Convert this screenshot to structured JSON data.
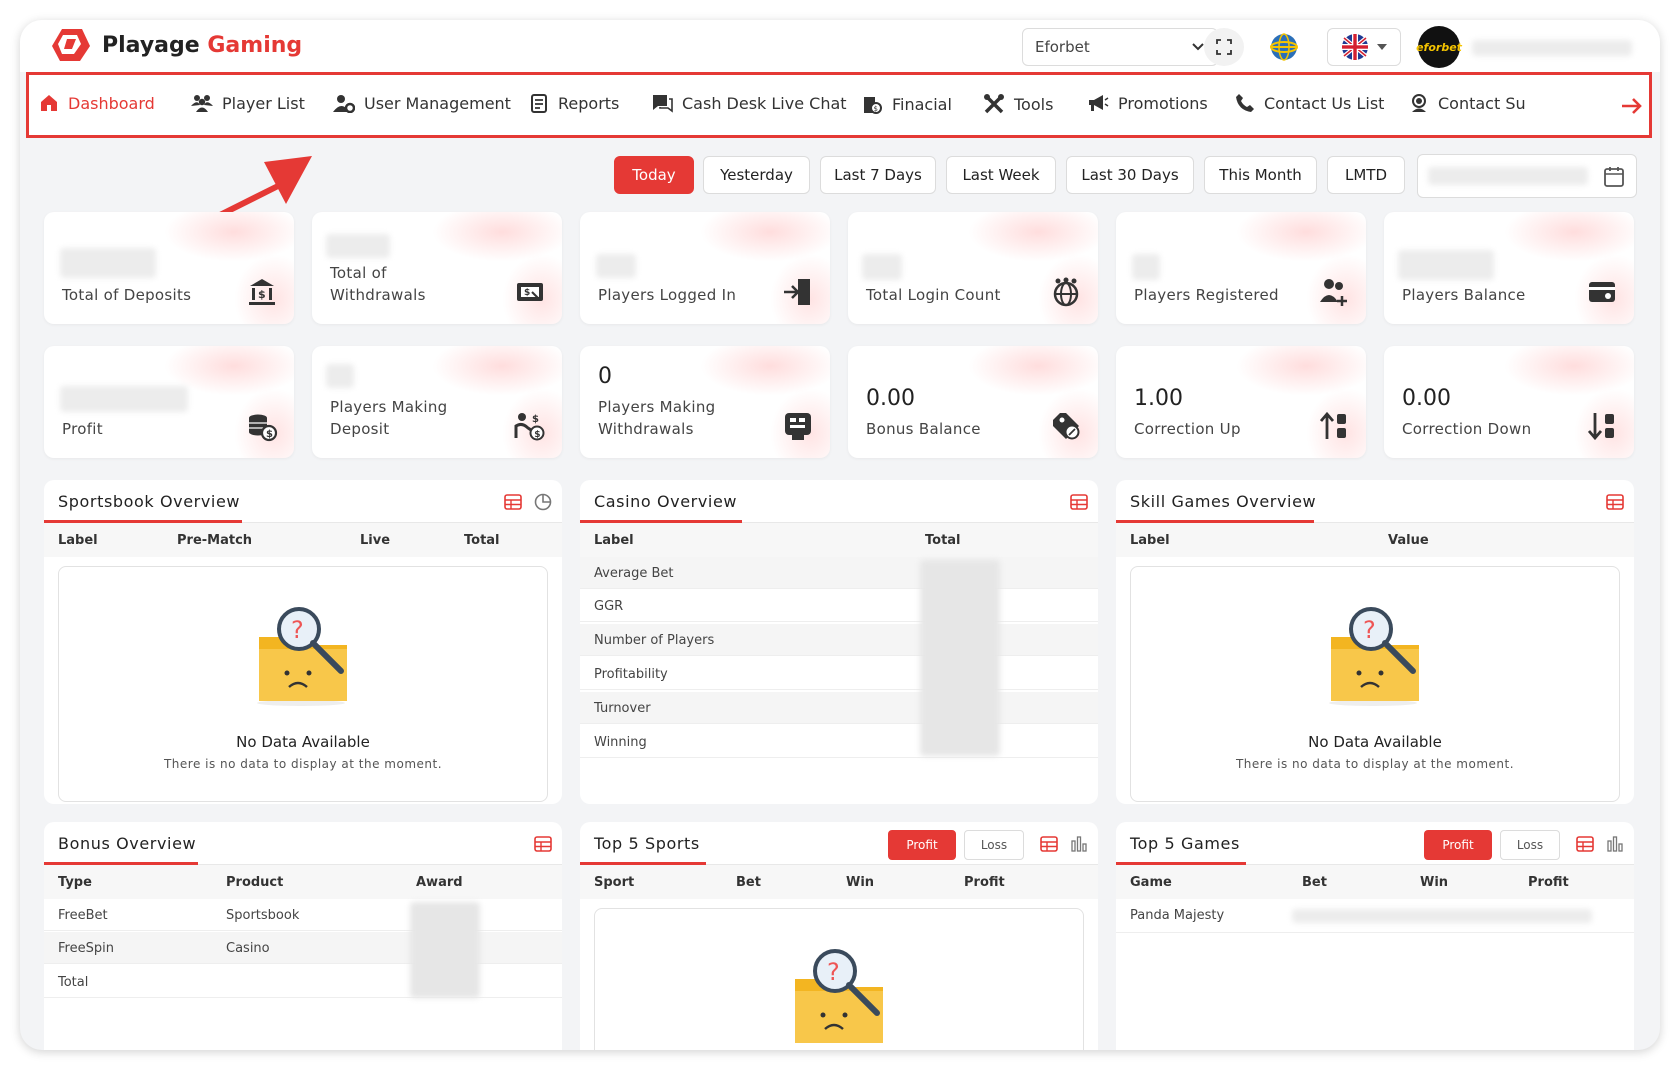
{
  "app": {
    "brand_main": "Playage",
    "brand_accent": "Gaming",
    "accent_color": "#e53935"
  },
  "header": {
    "site_select": "Eforbet",
    "avatar_text": "eforbet"
  },
  "nav": {
    "items": [
      {
        "label": "Dashboard",
        "icon": "home-icon"
      },
      {
        "label": "Player List",
        "icon": "users-icon"
      },
      {
        "label": "User Management",
        "icon": "user-gear-icon"
      },
      {
        "label": "Reports",
        "icon": "report-icon"
      },
      {
        "label": "Cash Desk Live Chat",
        "icon": "chat-icon"
      },
      {
        "label": "Finacial",
        "icon": "finance-icon"
      },
      {
        "label": "Tools",
        "icon": "tools-icon"
      },
      {
        "label": "Promotions",
        "icon": "megaphone-icon"
      },
      {
        "label": "Contact Us List",
        "icon": "phone-icon"
      },
      {
        "label": "Contact Su",
        "icon": "support-icon"
      }
    ]
  },
  "dates": {
    "buttons": [
      "Today",
      "Yesterday",
      "Last 7 Days",
      "Last Week",
      "Last 30 Days",
      "This Month",
      "LMTD"
    ],
    "active": "Today"
  },
  "stats": [
    {
      "value": "",
      "label": "Total of Deposits"
    },
    {
      "value": "",
      "label": "Total of Withdrawals"
    },
    {
      "value": "",
      "label": "Players Logged In"
    },
    {
      "value": "",
      "label": "Total Login Count"
    },
    {
      "value": "",
      "label": "Players Registered"
    },
    {
      "value": "",
      "label": "Players Balance"
    },
    {
      "value": "",
      "label": "Profit"
    },
    {
      "value": "",
      "label": "Players Making Deposit"
    },
    {
      "value": "0",
      "label": "Players Making Withdrawals"
    },
    {
      "value": "0.00",
      "label": "Bonus Balance"
    },
    {
      "value": "1.00",
      "label": "Correction Up"
    },
    {
      "value": "0.00",
      "label": "Correction Down"
    }
  ],
  "sportsbook": {
    "title": "Sportsbook Overview",
    "columns": [
      "Label",
      "Pre-Match",
      "Live",
      "Total"
    ],
    "empty_title": "No Data Available",
    "empty_sub": "There is no data to display at the moment."
  },
  "casino": {
    "title": "Casino Overview",
    "columns": [
      "Label",
      "Total"
    ],
    "rows": [
      "Average Bet",
      "GGR",
      "Number of Players",
      "Profitability",
      "Turnover",
      "Winning"
    ]
  },
  "skill": {
    "title": "Skill Games Overview",
    "columns": [
      "Label",
      "Value"
    ],
    "empty_title": "No Data Available",
    "empty_sub": "There is no data to display at the moment."
  },
  "bonus": {
    "title": "Bonus Overview",
    "columns": [
      "Type",
      "Product",
      "Award"
    ],
    "rows": [
      [
        "FreeBet",
        "Sportsbook"
      ],
      [
        "FreeSpin",
        "Casino"
      ],
      [
        "Total",
        ""
      ]
    ]
  },
  "top_sports": {
    "title": "Top 5 Sports",
    "toggle_on": "Profit",
    "toggle_off": "Loss",
    "columns": [
      "Sport",
      "Bet",
      "Win",
      "Profit"
    ]
  },
  "top_games": {
    "title": "Top 5 Games",
    "toggle_on": "Profit",
    "toggle_off": "Loss",
    "columns": [
      "Game",
      "Bet",
      "Win",
      "Profit"
    ],
    "rows": [
      "Panda Majesty"
    ]
  }
}
